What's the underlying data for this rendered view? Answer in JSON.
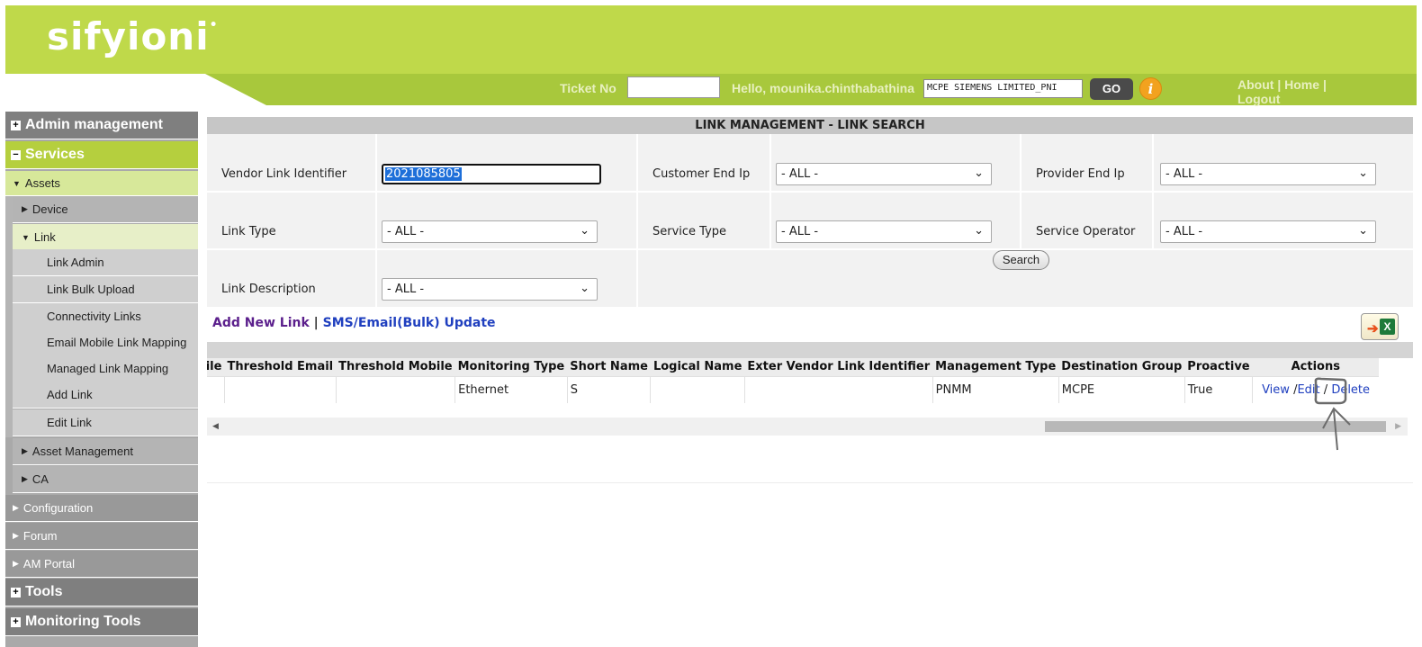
{
  "header": {
    "logo": "sifyioni",
    "ticket_label": "Ticket No",
    "ticket_value": "",
    "greeting": "Hello, mounika.chinthabathina",
    "customer_select": "MCPE SIEMENS LIMITED_PNI",
    "go_label": "GO",
    "info_glyph": "i",
    "links": [
      "About",
      "Home",
      "Logout"
    ]
  },
  "sidebar": {
    "admin": "Admin management",
    "services": "Services",
    "assets": "Assets",
    "device": "Device",
    "link": "Link",
    "link_items": [
      "Link Admin",
      "Link Bulk Upload",
      "Connectivity Links",
      "Email Mobile Link Mapping",
      "Managed Link Mapping",
      "Add Link",
      "Edit Link"
    ],
    "asset_management": "Asset Management",
    "ca": "CA",
    "configuration": "Configuration",
    "forum": "Forum",
    "am_portal": "AM Portal",
    "tools": "Tools",
    "monitoring_tools": "Monitoring Tools"
  },
  "panel": {
    "title": "LINK MANAGEMENT - LINK SEARCH",
    "fields": {
      "vendor_link_label": "Vendor Link  Identifier",
      "vendor_link_value": "2021085805",
      "customer_end_ip_label": "Customer End Ip",
      "customer_end_ip_value": "- ALL -",
      "provider_end_ip_label": "Provider End Ip",
      "provider_end_ip_value": "- ALL -",
      "link_type_label": "Link Type",
      "link_type_value": "- ALL -",
      "service_type_label": "Service Type",
      "service_type_value": "- ALL -",
      "service_operator_label": "Service Operator",
      "service_operator_value": "- ALL -",
      "link_description_label": "Link Description",
      "link_description_value": "- ALL -"
    },
    "search_label": "Search",
    "add_new_link": "Add New Link",
    "link_separator": "|",
    "sms_email_update": "SMS/Email(Bulk) Update"
  },
  "table": {
    "columns": [
      "bile",
      "Threshold Email",
      "Threshold Mobile",
      "Monitoring Type",
      "Short Name",
      "Logical Name",
      "Exter Vendor Link Identifier",
      "Management Type",
      "Destination Group",
      "Proactive",
      "Actions"
    ],
    "row": [
      "",
      "",
      "",
      "Ethernet",
      "S",
      "",
      "",
      "PNMM",
      "MCPE",
      "True"
    ],
    "actions": {
      "view": "View",
      "edit": "Edit",
      "delete": "Delete",
      "sep": "/"
    }
  },
  "colors": {
    "brand_green": "#bfd94a",
    "bar_green": "#a8c83c",
    "link_blue": "#1f3fbf"
  }
}
